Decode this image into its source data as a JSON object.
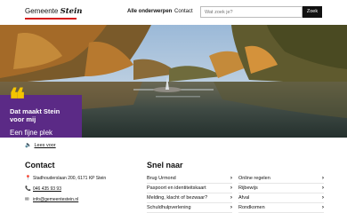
{
  "header": {
    "logo_prefix": "Gemeente",
    "logo_name": "Stein",
    "nav_all": "Alle onderwerpen",
    "nav_contact": "Contact",
    "search_placeholder": "Wat zoek je?",
    "search_button": "Zoek"
  },
  "hero": {
    "quote": "❝",
    "title_line1": "Dat maakt Stein",
    "title_line2": "voor mij",
    "subtitle": "Een fijne plek"
  },
  "readspeaker": {
    "label": "Lees voor"
  },
  "contact": {
    "heading": "Contact",
    "address": "Stadhouderslaan 200, 6171 KP Stein",
    "phone": "046 435 93 93",
    "email": "info@gemeentestein.nl"
  },
  "quicklinks": {
    "heading": "Snel naar",
    "left": [
      "Brug Urmond",
      "Paspoort en identiteitskaart",
      "Melding, klacht of bezwaar?",
      "Schuldhulpverlening"
    ],
    "right": [
      "Online regelen",
      "Rijbewijs",
      "Afval",
      "Rondkomen"
    ]
  },
  "colors": {
    "accent_red": "#d61c1c",
    "hero_purple": "#5b2a86",
    "quote_yellow": "#f4c400"
  }
}
